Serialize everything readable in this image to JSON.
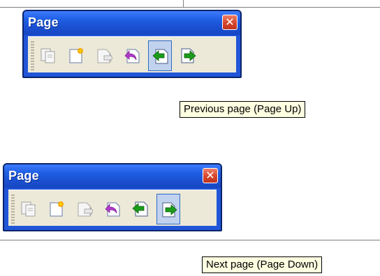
{
  "panels": [
    {
      "title": "Page",
      "close_symbol": "✕",
      "active_button": "previous-page",
      "tooltip": "Previous page (Page Up)"
    },
    {
      "title": "Page",
      "close_symbol": "✕",
      "active_button": "next-page",
      "tooltip": "Next page (Page Down)"
    }
  ],
  "buttons": [
    {
      "id": "copy-pages",
      "icon": "copy-pages-icon",
      "enabled": false
    },
    {
      "id": "new-page",
      "icon": "new-page-icon",
      "enabled": true
    },
    {
      "id": "delete-page",
      "icon": "delete-page-icon",
      "enabled": false
    },
    {
      "id": "undo-page",
      "icon": "undo-page-icon",
      "enabled": true
    },
    {
      "id": "previous-page",
      "icon": "previous-page-icon",
      "enabled": true
    },
    {
      "id": "next-page",
      "icon": "next-page-icon",
      "enabled": true
    }
  ],
  "colors": {
    "titlebar": "#2156d8",
    "close": "#d5452b",
    "toolbar_body": "#ece9d8",
    "tooltip_bg": "#ffffe1",
    "arrow_green": "#1a9c1a",
    "undo_purple": "#b03ac8",
    "star_orange": "#f0a000"
  }
}
